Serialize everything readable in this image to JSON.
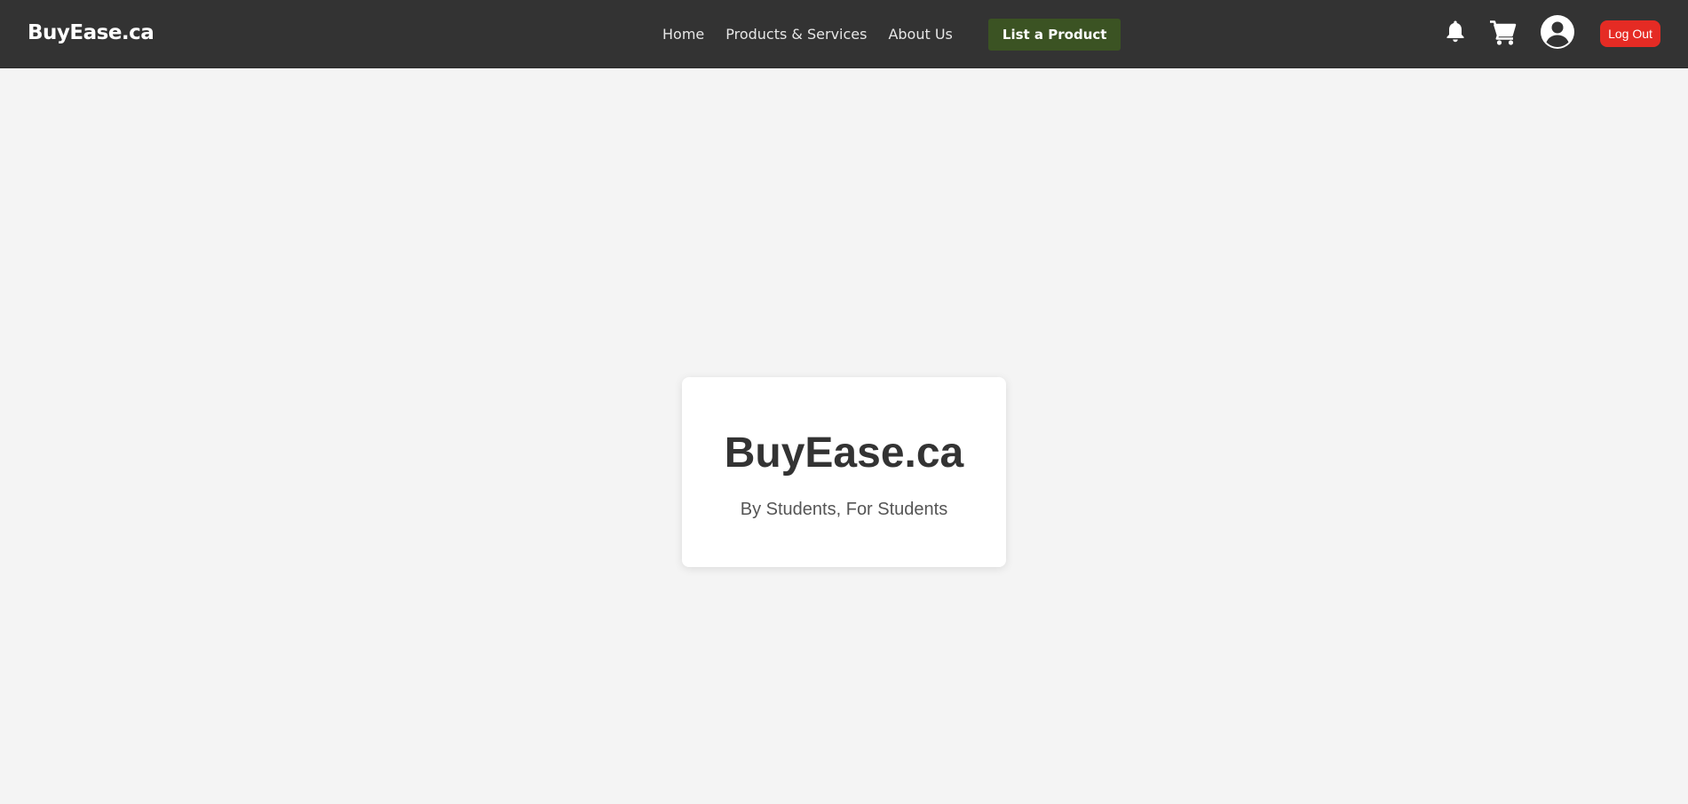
{
  "header": {
    "brand": "BuyEase.ca",
    "nav": {
      "home": "Home",
      "products": "Products & Services",
      "about": "About Us"
    },
    "list_product_label": "List a Product",
    "icons": [
      "bell-icon",
      "cart-icon",
      "user-account-icon"
    ],
    "logout_label": "Log Out"
  },
  "hero": {
    "title": "BuyEase.ca",
    "subtitle": "By Students, For Students"
  },
  "colors": {
    "navbar": "#333333",
    "page_background": "#f4f4f4",
    "list_button": "#3b5323",
    "logout_button": "#e52b24"
  }
}
